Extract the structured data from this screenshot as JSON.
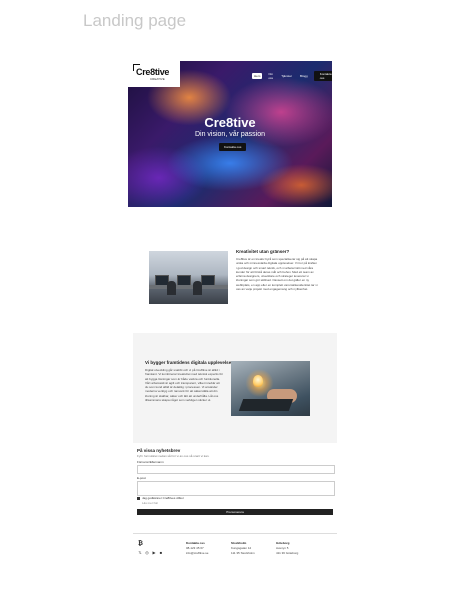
{
  "page_title": "Landing page",
  "hero": {
    "logo": "Cre8tive",
    "logo_sub": "CREATIVE",
    "nav": [
      "Hem",
      "Om oss",
      "Tjänster",
      "Blogg"
    ],
    "nav_cta": "Kontakta oss",
    "title": "Cre8tive",
    "subtitle": "Din vision, vår passion",
    "button": "Kontakta oss"
  },
  "about": {
    "heading": "Kreativitet utan gränser?",
    "body": "Cre8tive är en kreativ byrå som specialiserar sig på att skapa unika och minnesvärda digitala upplevelser. Vi tror på kraften i god design och smart teknik, och vi arbetar tätt med våra kunder för att förstå deras mål och behov. Med ett team av erfarna designers, utvecklare och strateger levererar vi lösningar som gör skillnad. Oavsett om det gäller en ny webbplats, en app eller en komplett varumärkesidentitet tar vi oss an varje projekt med engagemang och nyfikenhet."
  },
  "digital": {
    "heading": "Vi bygger framtidens digitala upplevelser",
    "body": "Digital utveckling går snabbt och vi på Cre8tive är alltid i framkant. Vi kombinerar kreativitet med teknisk expertis för att bygga lösningar som är både vackra och funktionella. Vårt arbetssätt är agilt och transparent, vilket innebär att du som kund alltid är delaktig i processen. Vi använder moderna verktyg och ramverk för att säkerställa att din lösning är skalbar, säker och lätt att underhålla. Låt oss tillsammans skapa något som verkligen sticker ut."
  },
  "contact": {
    "title": "På vissa nyhetsbrev",
    "subtitle": "Fyll i formuläret nedan så hör vi av oss så snart vi kan.",
    "name_label": "Förnamn/Efternamn",
    "email_label": "E-post",
    "checkbox_label": "Jag godkänner Cre8tives villkor",
    "checkbox_sub": "Läs mer här",
    "submit": "Prenumerera"
  },
  "footer": {
    "logo": "Cre8tive",
    "social_icons": [
      "x-icon",
      "instagram-icon",
      "youtube-icon",
      "linkedin-icon"
    ],
    "col1": {
      "heading": "Kontakta oss",
      "lines": [
        "08-123 45 67",
        "info@cre8tive.se"
      ]
    },
    "col2": {
      "heading": "Stockholm",
      "lines": [
        "Kungsgatan 12",
        "111 35 Stockholm"
      ]
    },
    "col3": {
      "heading": "Göteborg",
      "lines": [
        "Avenyn 5",
        "411 36 Göteborg"
      ]
    }
  }
}
